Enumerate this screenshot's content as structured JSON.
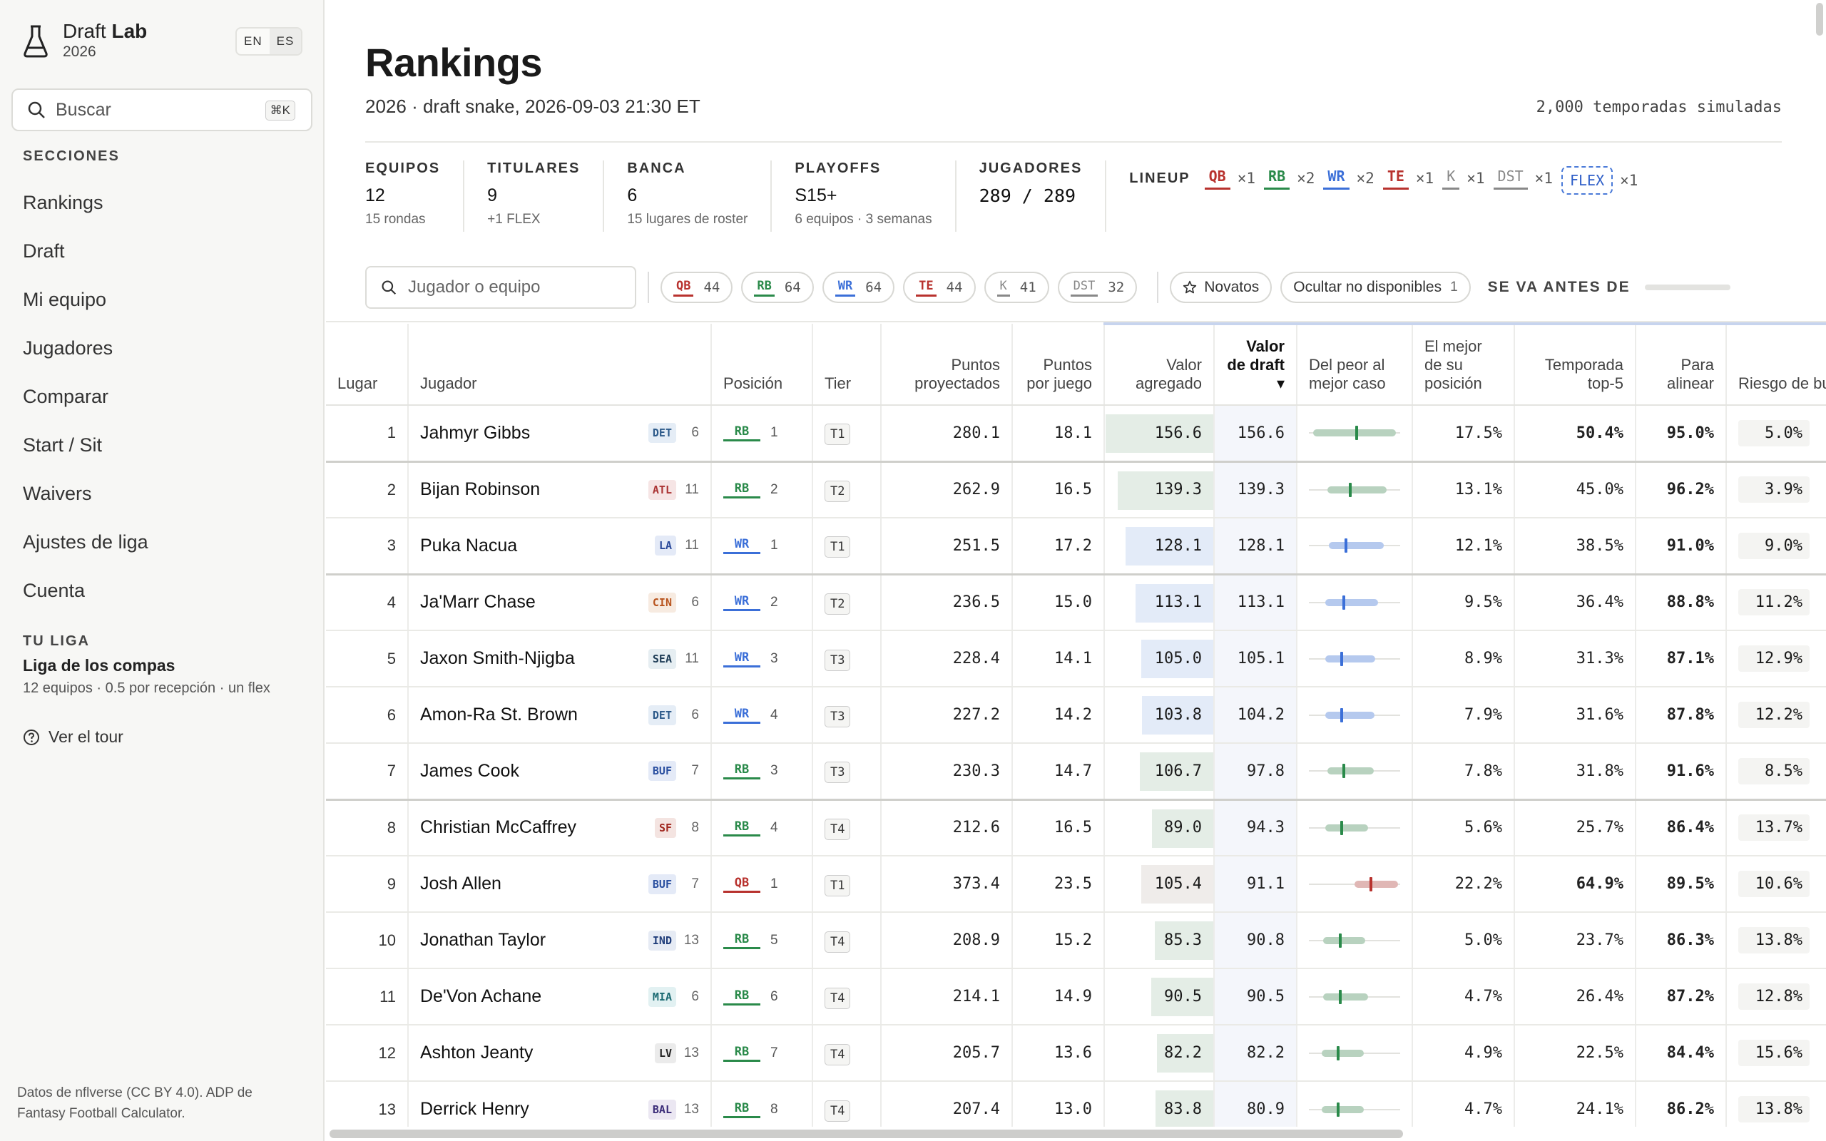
{
  "brand": {
    "name_plain": "Draft",
    "name_bold": "Lab",
    "year": "2026"
  },
  "lang": {
    "en": "EN",
    "es": "ES"
  },
  "sidebar": {
    "search_placeholder": "Buscar",
    "search_shortcut": "⌘K",
    "sections_title": "SECCIONES",
    "items": [
      {
        "label": "Rankings"
      },
      {
        "label": "Draft"
      },
      {
        "label": "Mi equipo"
      },
      {
        "label": "Jugadores"
      },
      {
        "label": "Comparar"
      },
      {
        "label": "Start / Sit"
      },
      {
        "label": "Waivers"
      },
      {
        "label": "Ajustes de liga"
      },
      {
        "label": "Cuenta"
      }
    ],
    "league_title": "TU LIGA",
    "league_name": "Liga de los compas",
    "league_meta": "12 equipos · 0.5 por recepción · un flex",
    "tour": "Ver el tour",
    "credits": "Datos de nflverse (CC BY 4.0). ADP de Fantasy Football Calculator."
  },
  "header": {
    "title": "Rankings",
    "subtitle": "2026 · draft snake, 2026-09-03 21:30 ET",
    "simulations": "2,000 temporadas simuladas"
  },
  "stats": [
    {
      "label": "EQUIPOS",
      "value": "12",
      "sub": "15 rondas"
    },
    {
      "label": "TITULARES",
      "value": "9",
      "sub": "+1 FLEX"
    },
    {
      "label": "BANCA",
      "value": "6",
      "sub": "15 lugares de roster"
    },
    {
      "label": "PLAYOFFS",
      "value": "S15+",
      "sub": "6 equipos · 3 semanas"
    },
    {
      "label": "JUGADORES",
      "value": "289 / 289",
      "sub": ""
    }
  ],
  "lineup": {
    "label": "LINEUP",
    "slots": [
      {
        "pos": "QB",
        "count": "×1"
      },
      {
        "pos": "RB",
        "count": "×2"
      },
      {
        "pos": "WR",
        "count": "×2"
      },
      {
        "pos": "TE",
        "count": "×1"
      },
      {
        "pos": "K",
        "count": "×1"
      },
      {
        "pos": "DST",
        "count": "×1"
      }
    ],
    "flex": {
      "pos": "FLEX",
      "count": "×1"
    }
  },
  "filters": {
    "search_placeholder": "Jugador o equipo",
    "positions": [
      {
        "pos": "QB",
        "count": "44"
      },
      {
        "pos": "RB",
        "count": "64"
      },
      {
        "pos": "WR",
        "count": "64"
      },
      {
        "pos": "TE",
        "count": "44"
      },
      {
        "pos": "K",
        "count": "41"
      },
      {
        "pos": "DST",
        "count": "32"
      }
    ],
    "rookies": "Novatos",
    "hide_unavailable": "Ocultar no disponibles",
    "hide_count": "1",
    "goes_before": "SE VA ANTES DE"
  },
  "colors": {
    "QB": "#b8322e",
    "RB": "#2a8a4a",
    "WR": "#3b6fd8",
    "TE": "#b8322e",
    "K": "#888888",
    "DST": "#888888",
    "FLEX": "#3b6fd8"
  },
  "table": {
    "headers": {
      "rank": "Lugar",
      "player": "Jugador",
      "position": "Posición",
      "tier": "Tier",
      "proj": "Puntos proyectados",
      "ppg": "Puntos por juego",
      "va": "Valor agregado",
      "dv": "Valor de draft ▾",
      "range": "Del peor al mejor caso",
      "best_pos": "El mejor de su posición",
      "top5": "Temporada top-5",
      "start": "Para alinear",
      "bust": "Riesgo de bust"
    },
    "rows": [
      {
        "rank": "1",
        "name": "Jahmyr Gibbs",
        "team": "DET",
        "bye": "6",
        "pos": "RB",
        "posrank": "1",
        "tier": "T1",
        "proj": "280.1",
        "ppg": "18.1",
        "va": "156.6",
        "dv": "156.6",
        "range": [
          0.05,
          0.52,
          0.95
        ],
        "best": "17.5%",
        "top5": "50.4%",
        "start": "95.0%",
        "bust": "5.0%"
      },
      {
        "rank": "2",
        "name": "Bijan Robinson",
        "team": "ATL",
        "bye": "11",
        "pos": "RB",
        "posrank": "2",
        "tier": "T2",
        "proj": "262.9",
        "ppg": "16.5",
        "va": "139.3",
        "dv": "139.3",
        "range": [
          0.2,
          0.45,
          0.85
        ],
        "best": "13.1%",
        "top5": "45.0%",
        "start": "96.2%",
        "bust": "3.9%"
      },
      {
        "rank": "3",
        "name": "Puka Nacua",
        "team": "LA",
        "bye": "11",
        "pos": "WR",
        "posrank": "1",
        "tier": "T1",
        "proj": "251.5",
        "ppg": "17.2",
        "va": "128.1",
        "dv": "128.1",
        "range": [
          0.22,
          0.41,
          0.82
        ],
        "best": "12.1%",
        "top5": "38.5%",
        "start": "91.0%",
        "bust": "9.0%"
      },
      {
        "rank": "4",
        "name": "Ja'Marr Chase",
        "team": "CIN",
        "bye": "6",
        "pos": "WR",
        "posrank": "2",
        "tier": "T2",
        "proj": "236.5",
        "ppg": "15.0",
        "va": "113.1",
        "dv": "113.1",
        "range": [
          0.18,
          0.38,
          0.76
        ],
        "best": "9.5%",
        "top5": "36.4%",
        "start": "88.8%",
        "bust": "11.2%"
      },
      {
        "rank": "5",
        "name": "Jaxon Smith-Njigba",
        "team": "SEA",
        "bye": "11",
        "pos": "WR",
        "posrank": "3",
        "tier": "T3",
        "proj": "228.4",
        "ppg": "14.1",
        "va": "105.0",
        "dv": "105.1",
        "range": [
          0.18,
          0.36,
          0.73
        ],
        "best": "8.9%",
        "top5": "31.3%",
        "start": "87.1%",
        "bust": "12.9%"
      },
      {
        "rank": "6",
        "name": "Amon-Ra St. Brown",
        "team": "DET",
        "bye": "6",
        "pos": "WR",
        "posrank": "4",
        "tier": "T3",
        "proj": "227.2",
        "ppg": "14.2",
        "va": "103.8",
        "dv": "104.2",
        "range": [
          0.18,
          0.36,
          0.72
        ],
        "best": "7.9%",
        "top5": "31.6%",
        "start": "87.8%",
        "bust": "12.2%"
      },
      {
        "rank": "7",
        "name": "James Cook",
        "team": "BUF",
        "bye": "7",
        "pos": "RB",
        "posrank": "3",
        "tier": "T3",
        "proj": "230.3",
        "ppg": "14.7",
        "va": "106.7",
        "dv": "97.8",
        "range": [
          0.2,
          0.38,
          0.71
        ],
        "best": "7.8%",
        "top5": "31.8%",
        "start": "91.6%",
        "bust": "8.5%"
      },
      {
        "rank": "8",
        "name": "Christian McCaffrey",
        "team": "SF",
        "bye": "8",
        "pos": "RB",
        "posrank": "4",
        "tier": "T4",
        "proj": "212.6",
        "ppg": "16.5",
        "va": "89.0",
        "dv": "94.3",
        "range": [
          0.18,
          0.36,
          0.65
        ],
        "best": "5.6%",
        "top5": "25.7%",
        "start": "86.4%",
        "bust": "13.7%"
      },
      {
        "rank": "9",
        "name": "Josh Allen",
        "team": "BUF",
        "bye": "7",
        "pos": "QB",
        "posrank": "1",
        "tier": "T1",
        "proj": "373.4",
        "ppg": "23.5",
        "va": "105.4",
        "dv": "91.1",
        "range": [
          0.5,
          0.68,
          0.98
        ],
        "best": "22.2%",
        "top5": "64.9%",
        "start": "89.5%",
        "bust": "10.6%"
      },
      {
        "rank": "10",
        "name": "Jonathan Taylor",
        "team": "IND",
        "bye": "13",
        "pos": "RB",
        "posrank": "5",
        "tier": "T4",
        "proj": "208.9",
        "ppg": "15.2",
        "va": "85.3",
        "dv": "90.8",
        "range": [
          0.16,
          0.34,
          0.62
        ],
        "best": "5.0%",
        "top5": "23.7%",
        "start": "86.3%",
        "bust": "13.8%"
      },
      {
        "rank": "11",
        "name": "De'Von Achane",
        "team": "MIA",
        "bye": "6",
        "pos": "RB",
        "posrank": "6",
        "tier": "T4",
        "proj": "214.1",
        "ppg": "14.9",
        "va": "90.5",
        "dv": "90.5",
        "range": [
          0.16,
          0.34,
          0.65
        ],
        "best": "4.7%",
        "top5": "26.4%",
        "start": "87.2%",
        "bust": "12.8%"
      },
      {
        "rank": "12",
        "name": "Ashton Jeanty",
        "team": "LV",
        "bye": "13",
        "pos": "RB",
        "posrank": "7",
        "tier": "T4",
        "proj": "205.7",
        "ppg": "13.6",
        "va": "82.2",
        "dv": "82.2",
        "range": [
          0.14,
          0.32,
          0.6
        ],
        "best": "4.9%",
        "top5": "22.5%",
        "start": "84.4%",
        "bust": "15.6%"
      },
      {
        "rank": "13",
        "name": "Derrick Henry",
        "team": "BAL",
        "bye": "13",
        "pos": "RB",
        "posrank": "8",
        "tier": "T4",
        "proj": "207.4",
        "ppg": "13.0",
        "va": "83.8",
        "dv": "80.9",
        "range": [
          0.14,
          0.32,
          0.6
        ],
        "best": "4.7%",
        "top5": "24.1%",
        "start": "86.2%",
        "bust": "13.8%"
      }
    ]
  },
  "team_colors": {
    "DET": [
      "#e5edf6",
      "#2d5a8a"
    ],
    "ATL": [
      "#f6e5e5",
      "#a33"
    ],
    "LA": [
      "#e4eaf7",
      "#2b4a9a"
    ],
    "CIN": [
      "#f7ebe1",
      "#b8541e"
    ],
    "SEA": [
      "#e6eef2",
      "#1d3b55"
    ],
    "BUF": [
      "#e4eaf7",
      "#2a4fa0"
    ],
    "SF": [
      "#f4e4e1",
      "#a0261e"
    ],
    "IND": [
      "#e6ebf4",
      "#1f3d7a"
    ],
    "MIA": [
      "#e2f1f2",
      "#1b6a72"
    ],
    "LV": [
      "#ebebeb",
      "#222"
    ],
    "BAL": [
      "#ebe7f2",
      "#3a2b78"
    ]
  }
}
